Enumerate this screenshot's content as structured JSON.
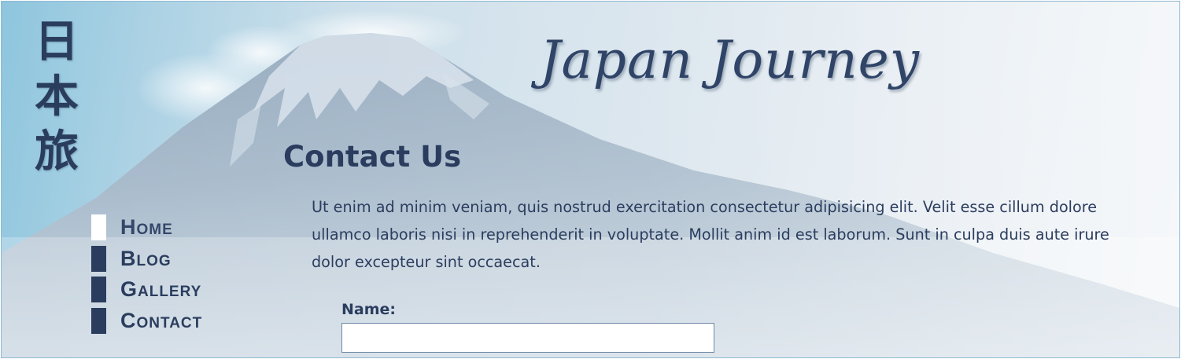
{
  "site": {
    "logo_kanji": [
      "日",
      "本",
      "旅"
    ],
    "title": "Japan Journey"
  },
  "nav": {
    "items": [
      {
        "label": "Home",
        "active": true
      },
      {
        "label": "Blog",
        "active": false
      },
      {
        "label": "Gallery",
        "active": false
      },
      {
        "label": "Contact",
        "active": false
      }
    ]
  },
  "main": {
    "heading": "Contact Us",
    "intro": "Ut enim ad minim veniam, quis nostrud exercitation consectetur adipisicing elit. Velit esse cillum dolore ullamco laboris nisi in reprehenderit in voluptate. Mollit anim id est laborum. Sunt in culpa duis aute irure dolor excepteur sint occaecat.",
    "form": {
      "name_label": "Name:",
      "name_value": "",
      "name_placeholder": ""
    }
  },
  "colors": {
    "text": "#2b3d5e",
    "nav_active_marker": "#ffffff",
    "sky": "#8ec6de",
    "mountain": "#7f9ab2"
  },
  "icons": {
    "background": "mount-fuji-photo"
  }
}
